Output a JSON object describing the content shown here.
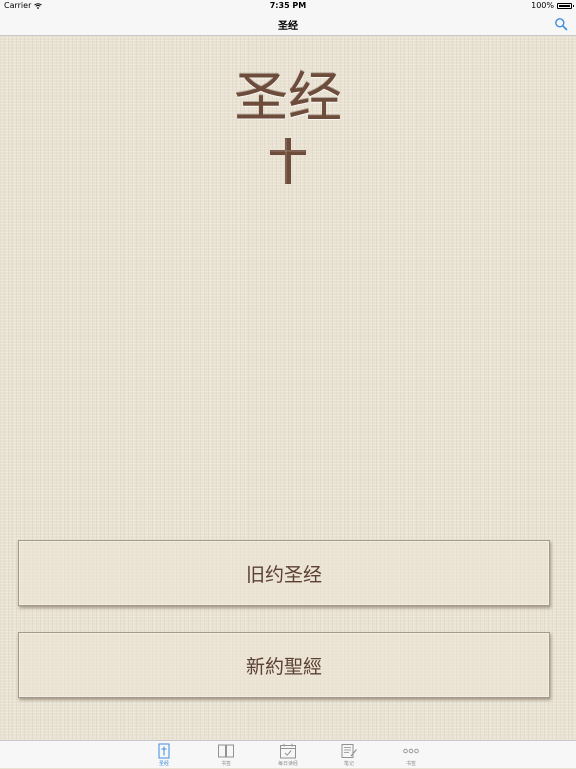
{
  "status_bar": {
    "carrier": "Carrier",
    "time": "7:35 PM",
    "battery": "100%",
    "battery_level": 1.0
  },
  "nav": {
    "title": "圣经",
    "search_icon": "search-icon"
  },
  "content": {
    "title": "圣经",
    "cross_icon": "cross-icon",
    "buttons": {
      "old_testament": "旧约圣经",
      "new_testament": "新約聖經"
    }
  },
  "tabs": [
    {
      "label": "圣经",
      "icon": "bible-cross-icon",
      "active": true
    },
    {
      "label": "书签",
      "icon": "open-book-icon",
      "active": false
    },
    {
      "label": "每日读经",
      "icon": "calendar-check-icon",
      "active": false
    },
    {
      "label": "笔记",
      "icon": "notepad-pencil-icon",
      "active": false
    },
    {
      "label": "书签",
      "icon": "more-dots-icon",
      "active": false
    }
  ],
  "colors": {
    "accent": "#3d8de0",
    "text_brown": "#6e4c3b",
    "background": "#e9e2d3"
  }
}
